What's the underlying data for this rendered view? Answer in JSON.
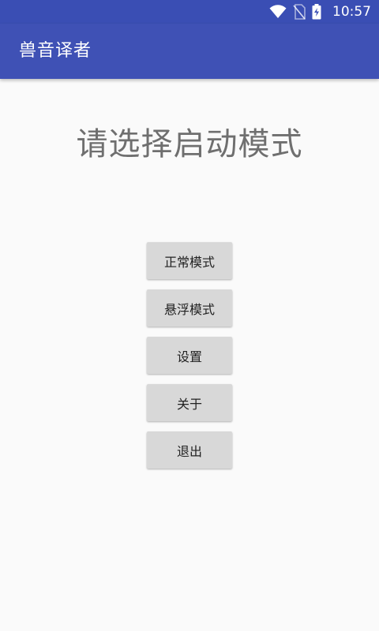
{
  "status_bar": {
    "time": "10:57",
    "icons": [
      "wifi-icon",
      "no-sim-icon",
      "battery-charging-icon"
    ]
  },
  "app_bar": {
    "title": "兽音译者"
  },
  "main": {
    "heading": "请选择启动模式",
    "buttons": [
      {
        "label": "正常模式"
      },
      {
        "label": "悬浮模式"
      },
      {
        "label": "设置"
      },
      {
        "label": "关于"
      },
      {
        "label": "退出"
      }
    ]
  },
  "colors": {
    "primary": "#3f51b5",
    "primary_dark": "#3a4eb4",
    "background": "#fafafa",
    "button": "#d8d8d8",
    "heading_text": "#6f6f6f"
  }
}
